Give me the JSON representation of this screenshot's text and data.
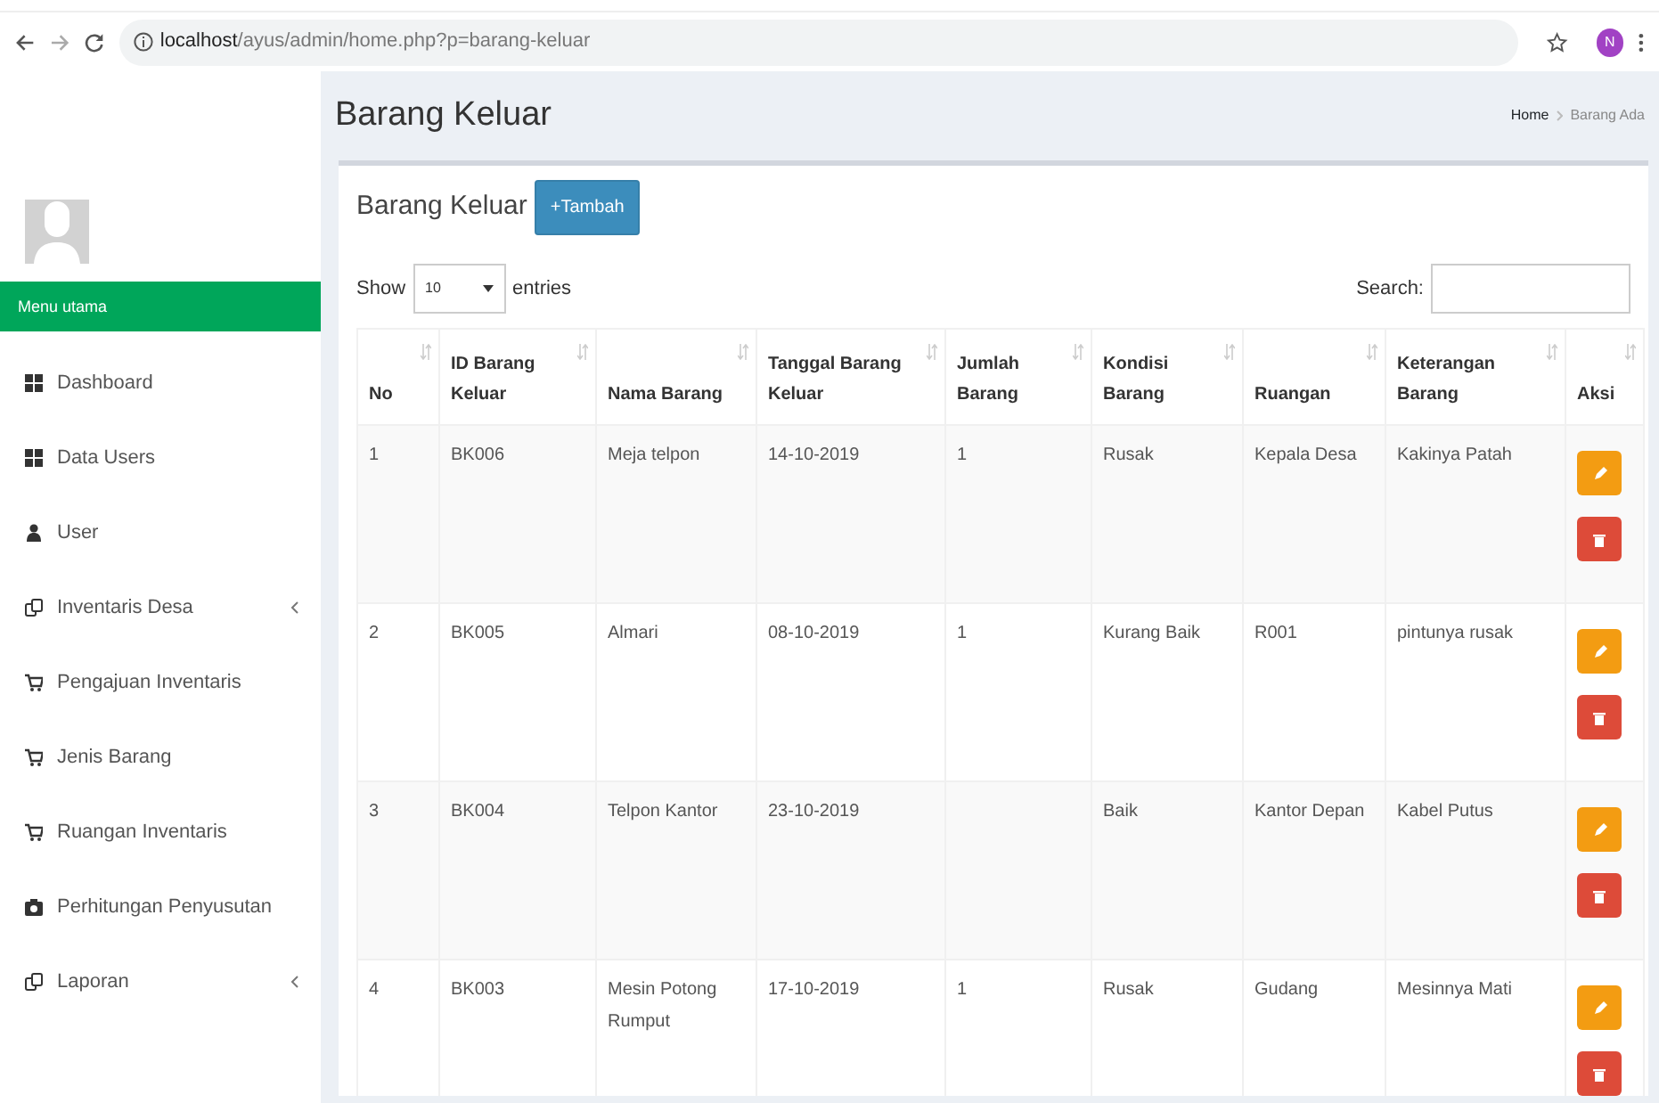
{
  "browser": {
    "url_host": "localhost",
    "url_path": "/ayus/admin/home.php?p=barang-keluar",
    "profile_initial": "N"
  },
  "sidebar": {
    "section_title": "Menu utama",
    "items": [
      {
        "label": "Dashboard",
        "kind": "grid",
        "has_submenu": false
      },
      {
        "label": "Data Users",
        "kind": "grid",
        "has_submenu": false
      },
      {
        "label": "User",
        "kind": "user",
        "has_submenu": false
      },
      {
        "label": "Inventaris Desa",
        "kind": "copy",
        "has_submenu": true
      },
      {
        "label": "Pengajuan Inventaris",
        "kind": "cart",
        "has_submenu": false
      },
      {
        "label": "Jenis Barang",
        "kind": "cart",
        "has_submenu": false
      },
      {
        "label": "Ruangan Inventaris",
        "kind": "cart",
        "has_submenu": false
      },
      {
        "label": "Perhitungan Penyusutan",
        "kind": "camera",
        "has_submenu": false
      },
      {
        "label": "Laporan",
        "kind": "copy",
        "has_submenu": true
      }
    ]
  },
  "page_title": "Barang Keluar",
  "breadcrumb": [
    "Home",
    "Barang Ada"
  ],
  "box": {
    "title": "Barang Keluar",
    "add_button": "+Tambah"
  },
  "length_menu": {
    "show": "Show",
    "value": "10",
    "entries": "entries"
  },
  "search": {
    "label": "Search:"
  },
  "table": {
    "columns": [
      "No",
      "ID Barang Keluar",
      "Nama Barang",
      "Tanggal Barang Keluar",
      "Jumlah Barang",
      "Kondisi Barang",
      "Ruangan",
      "Keterangan Barang",
      "Aksi"
    ],
    "rows": [
      [
        "1",
        "BK006",
        "Meja telpon",
        "14-10-2019",
        "1",
        "Rusak",
        "Kepala Desa",
        "Kakinya Patah"
      ],
      [
        "2",
        "BK005",
        "Almari",
        "08-10-2019",
        "1",
        "Kurang Baik",
        "R001",
        "pintunya rusak"
      ],
      [
        "3",
        "BK004",
        "Telpon Kantor",
        "23-10-2019",
        "",
        "Baik",
        "Kantor Depan",
        "Kabel Putus"
      ],
      [
        "4",
        "BK003",
        "Mesin Potong Rumput",
        "17-10-2019",
        "1",
        "Rusak",
        "Gudang",
        "Mesinnya Mati"
      ]
    ]
  }
}
